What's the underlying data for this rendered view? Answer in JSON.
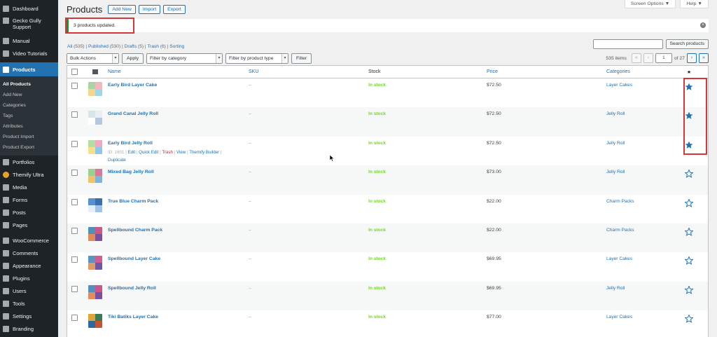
{
  "sidebar": {
    "items_top": [
      {
        "label": "Dashboard"
      },
      {
        "label": "Gecko Gully Support"
      },
      {
        "label": "Manual"
      },
      {
        "label": "Video Tutorials"
      }
    ],
    "active": {
      "label": "Products"
    },
    "submenu": [
      "All Products",
      "Add New",
      "Categories",
      "Tags",
      "Attributes",
      "Product Import",
      "Product Export"
    ],
    "items_bottom": [
      {
        "label": "Portfolios"
      },
      {
        "label": "Themify Ultra"
      },
      {
        "label": "Media"
      },
      {
        "label": "Forms"
      },
      {
        "label": "Posts"
      },
      {
        "label": "Pages"
      },
      {
        "label": "WooCommerce"
      },
      {
        "label": "Comments"
      },
      {
        "label": "Appearance"
      },
      {
        "label": "Plugins"
      },
      {
        "label": "Users"
      },
      {
        "label": "Tools"
      },
      {
        "label": "Settings"
      },
      {
        "label": "Branding"
      }
    ]
  },
  "header": {
    "title": "Products",
    "add_new": "Add New",
    "import": "Import",
    "export": "Export",
    "screen_options": "Screen Options ▼",
    "help": "Help ▼"
  },
  "notice": {
    "text": "3 products updated."
  },
  "filters": {
    "all": "All",
    "all_count": "(535)",
    "published": "Published",
    "published_count": "(530)",
    "drafts": "Drafts",
    "drafts_count": "(5)",
    "trash": "Trash",
    "trash_count": "(6)",
    "sorting": "Sorting"
  },
  "search": {
    "button": "Search products"
  },
  "tablenav": {
    "bulk_actions": "Bulk Actions",
    "apply": "Apply",
    "filter_category": "Filter by category",
    "filter_type": "Filter by product type",
    "filter": "Filter",
    "items": "535 items",
    "first": "«",
    "prev": "‹",
    "current_page": "1",
    "of_pages": "of 27",
    "next": "›",
    "last": "»"
  },
  "columns": {
    "name": "Name",
    "sku": "SKU",
    "stock": "Stock",
    "price": "Price",
    "categories": "Categories",
    "featured": "★"
  },
  "row_actions": {
    "id": "ID: 1601 |",
    "edit": "Edit",
    "quick_edit": "Quick Edit",
    "trash": "Trash",
    "view": "View",
    "builder": "Themify Builder",
    "duplicate": "Duplicate"
  },
  "products": [
    {
      "name": "Early Bird Layer Cake",
      "sku": "–",
      "stock": "In stock",
      "price": "$72.50",
      "category": "Layer Cakes",
      "featured": true
    },
    {
      "name": "Grand Canal Jelly Roll",
      "sku": "–",
      "stock": "In stock",
      "price": "$72.50",
      "category": "Jelly Roll",
      "featured": true
    },
    {
      "name": "Early Bird Jelly Roll",
      "sku": "–",
      "stock": "In stock",
      "price": "$72.50",
      "category": "Jelly Roll",
      "featured": true
    },
    {
      "name": "Mixed Bag Jelly Roll",
      "sku": "–",
      "stock": "In stock",
      "price": "$73.00",
      "category": "Jelly Roll",
      "featured": false
    },
    {
      "name": "True Blue Charm Pack",
      "sku": "–",
      "stock": "In stock",
      "price": "$22.00",
      "category": "Charm Packs",
      "featured": false
    },
    {
      "name": "Spellbound Charm Pack",
      "sku": "–",
      "stock": "In stock",
      "price": "$22.00",
      "category": "Charm Packs",
      "featured": false
    },
    {
      "name": "Spellbound Layer Cake",
      "sku": "–",
      "stock": "In stock",
      "price": "$69.95",
      "category": "Layer Cakes",
      "featured": false
    },
    {
      "name": "Spellbound Jelly Roll",
      "sku": "–",
      "stock": "In stock",
      "price": "$69.95",
      "category": "Jelly Roll",
      "featured": false
    },
    {
      "name": "Tiki Batiks Layer Cake",
      "sku": "–",
      "stock": "In stock",
      "price": "$77.00",
      "category": "Layer Cakes",
      "featured": false
    }
  ],
  "colors": {
    "accent": "#2271b1",
    "sidebar": "#1d2327",
    "stock": "#7ad03a",
    "highlight": "#d63638",
    "notice": "#00a32a"
  }
}
